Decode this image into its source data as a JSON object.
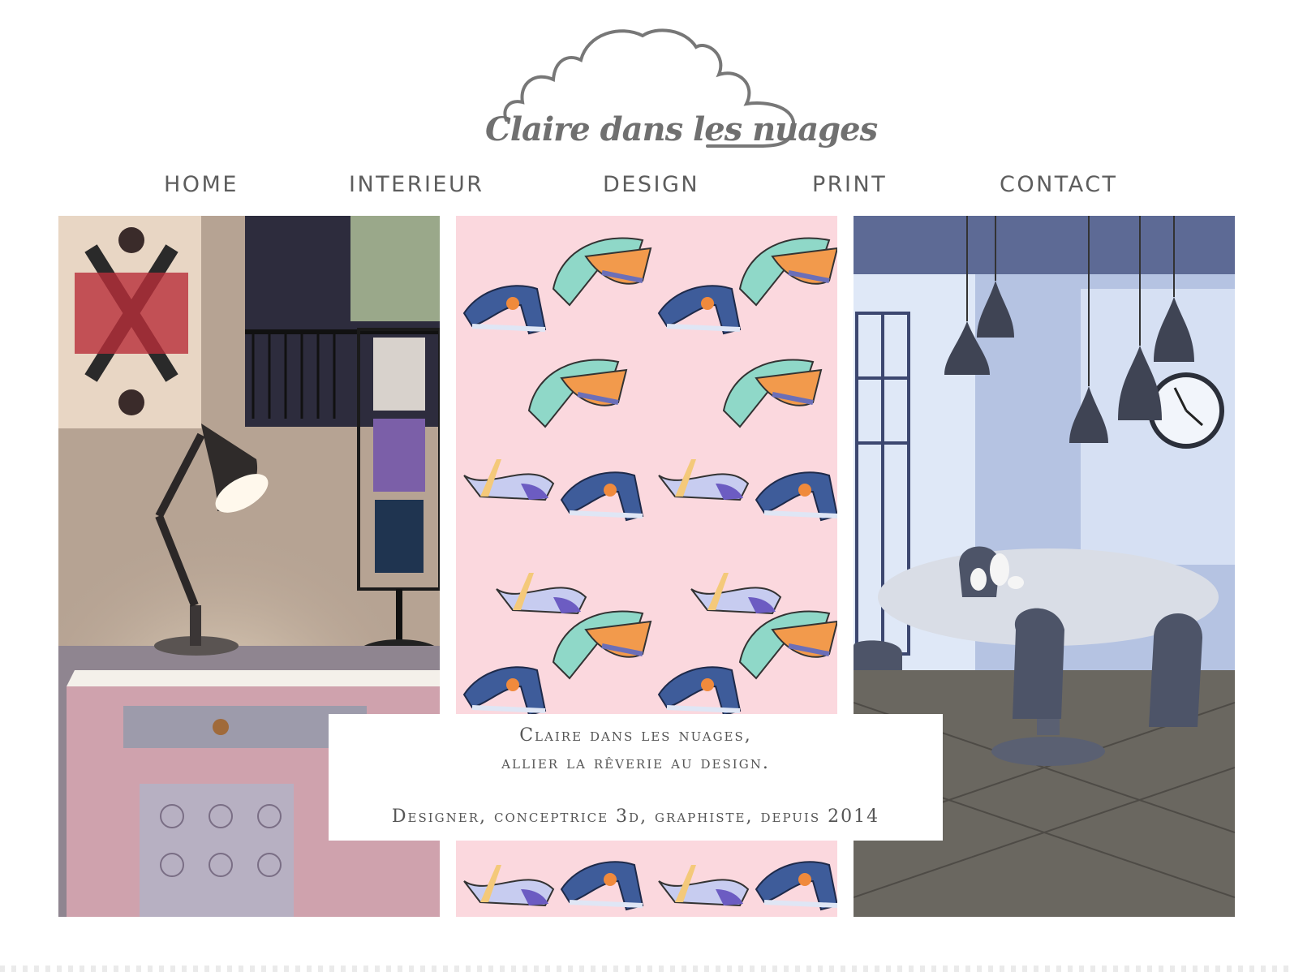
{
  "logo": {
    "text": "Claire dans les nuages",
    "icon": "cloud-icon"
  },
  "nav": {
    "items": [
      {
        "label": "HOME"
      },
      {
        "label": "INTERIEUR"
      },
      {
        "label": "DESIGN"
      },
      {
        "label": "PRINT"
      },
      {
        "label": "CONTACT"
      }
    ]
  },
  "tagline": {
    "line1": "Claire dans les nuages,",
    "line2": "allier la rêverie au design.",
    "line3": "Designer, conceptrice 3d, graphiste, depuis 2014"
  },
  "colors": {
    "nav_text": "#5d5d5d",
    "logo_stroke": "#777777",
    "pattern_bg": "#fbd8de"
  }
}
